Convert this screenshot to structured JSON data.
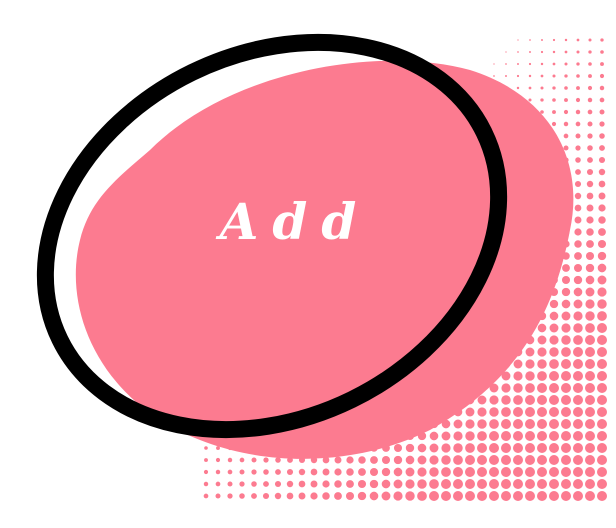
{
  "button": {
    "label": "Add"
  },
  "colors": {
    "blob": "#fc7b90",
    "ring": "#000000",
    "dots": "#fc7b90",
    "text": "#ffffff"
  },
  "icons": {
    "decoration": "halftone-dots"
  }
}
